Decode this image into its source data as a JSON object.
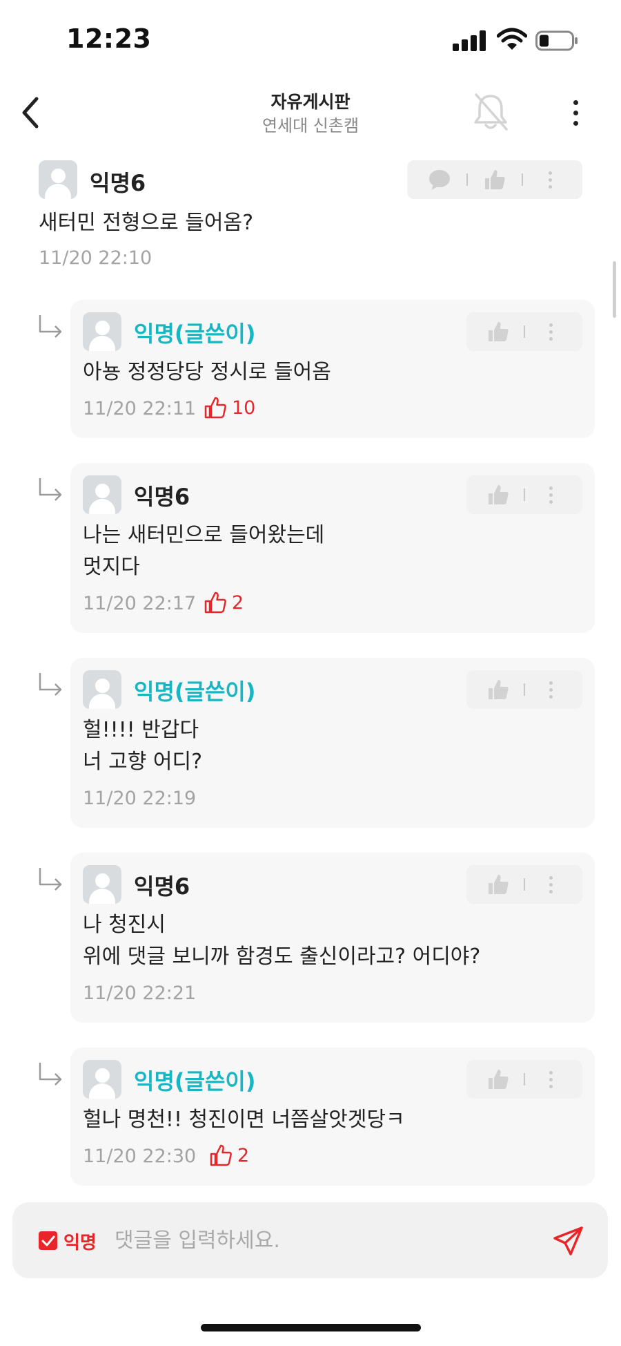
{
  "status": {
    "time": "12:23"
  },
  "header": {
    "title": "자유게시판",
    "subtitle": "연세대 신촌캠"
  },
  "post_comment": {
    "author": "익명6",
    "text": "새터민 전형으로 들어옴?",
    "time": "11/20 22:10"
  },
  "replies": [
    {
      "author": "익명(글쓴이)",
      "is_op": true,
      "text": "아뇽 정정당당 정시로 들어옴",
      "time": "11/20 22:11",
      "likes": "10"
    },
    {
      "author": "익명6",
      "is_op": false,
      "text": "나는 새터민으로 들어왔는데\n멋지다",
      "time": "11/20 22:17",
      "likes": "2"
    },
    {
      "author": "익명(글쓴이)",
      "is_op": true,
      "text": "헐!!!! 반갑다\n너 고향 어디?",
      "time": "11/20 22:19",
      "likes": ""
    },
    {
      "author": "익명6",
      "is_op": false,
      "text": "나 청진시\n위에 댓글 보니까 함경도 출신이라고? 어디야?",
      "time": "11/20 22:21",
      "likes": ""
    },
    {
      "author": "익명(글쓴이)",
      "is_op": true,
      "text": "헐나 명천!! 청진이면 너쯤살앗겟당ㅋ",
      "time": "11/20 22:30",
      "likes": "2"
    }
  ],
  "input": {
    "anon_label": "익명",
    "placeholder": "댓글을 입력하세요."
  },
  "colors": {
    "op_author": "#19b5c3",
    "like_red": "#e8262a",
    "card_bg": "#f7f7f7"
  },
  "icons": {
    "back": "chevron-left-icon",
    "bell": "bell-off-icon",
    "more": "more-vertical-icon",
    "reply": "speech-bubble-icon",
    "like": "thumbs-up-icon",
    "send": "send-icon"
  }
}
